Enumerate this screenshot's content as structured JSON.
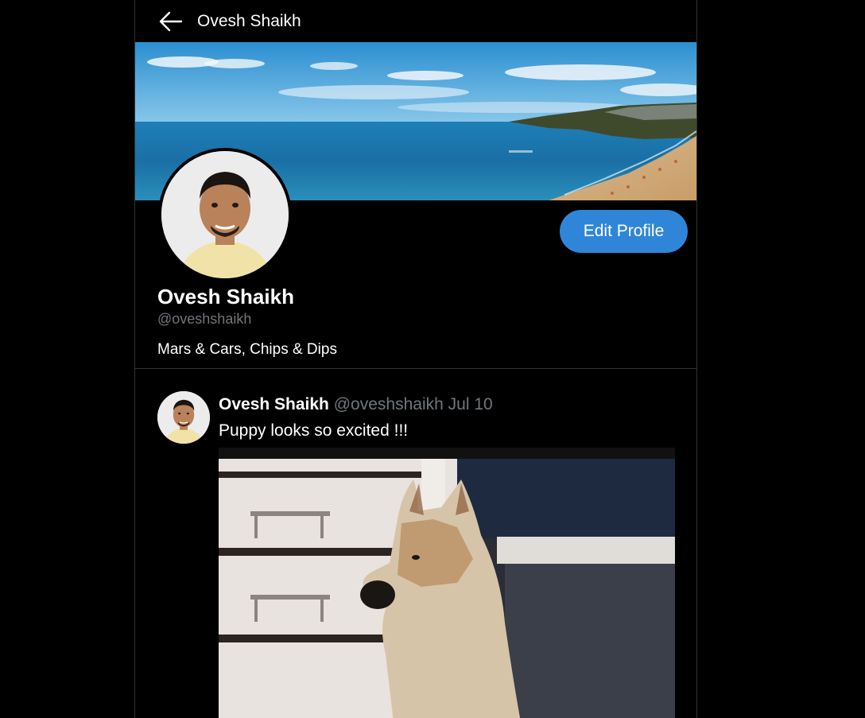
{
  "header": {
    "back_icon": "arrow-left-icon",
    "title": "Ovesh Shaikh"
  },
  "profile": {
    "name": "Ovesh Shaikh",
    "handle": "@oveshshaikh",
    "bio": "Mars & Cars, Chips & Dips",
    "edit_button_label": "Edit Profile"
  },
  "tweets": [
    {
      "author": "Ovesh Shaikh",
      "handle": "@oveshshaikh",
      "date": "Jul 10",
      "text": "Puppy looks so excited !!!"
    }
  ],
  "colors": {
    "background": "#000000",
    "accent": "#2f86d8",
    "muted_text": "#71767b",
    "border": "#2f3336"
  }
}
